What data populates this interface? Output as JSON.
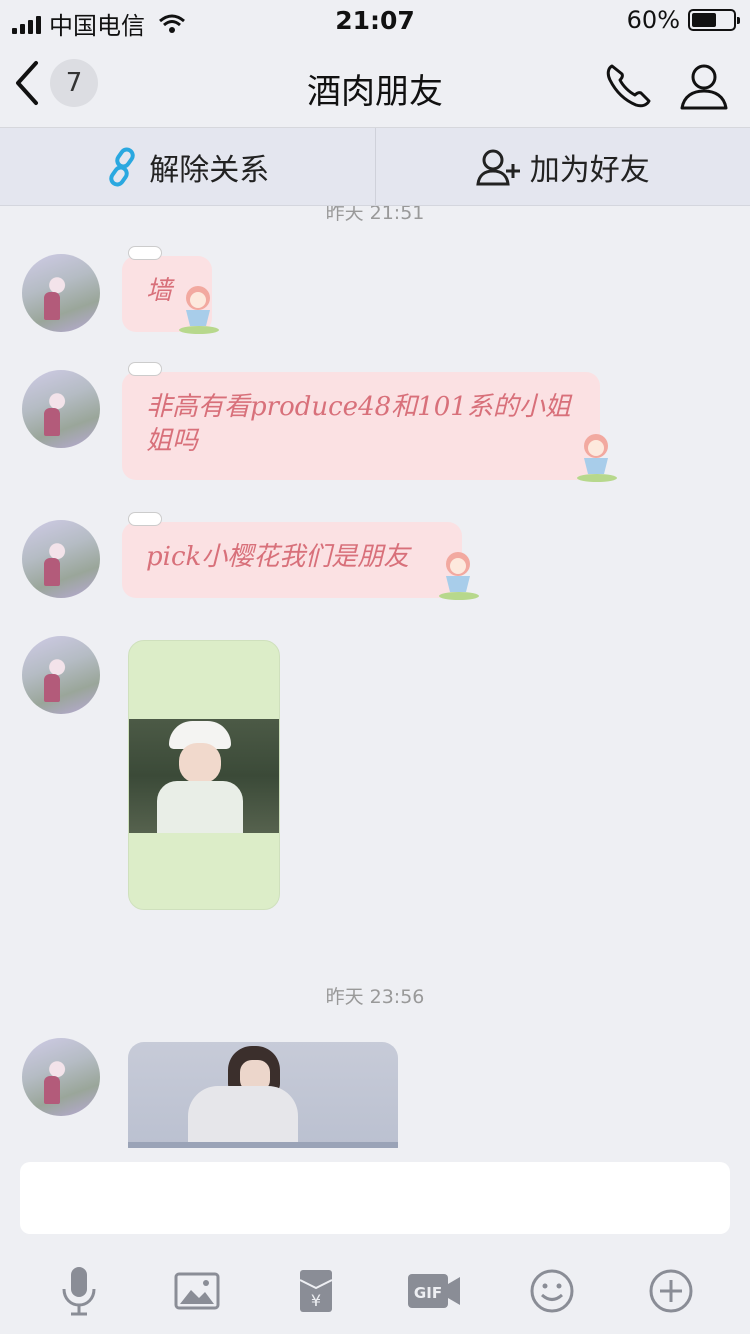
{
  "status_bar": {
    "carrier": "中国电信",
    "time": "21:07",
    "battery": "60%",
    "battery_level": 0.6
  },
  "nav": {
    "unread_count": "7",
    "title": "酒肉朋友"
  },
  "actions": {
    "unlink_label": "解除关系",
    "add_friend_label": "加为好友"
  },
  "messages": {
    "timestamp_1": "昨天 21:51",
    "msg_1": "墙",
    "msg_2": "非高有看produce48和101系的小姐姐吗",
    "msg_3": "pick小樱花我们是朋友",
    "timestamp_2": "昨天 23:56"
  },
  "colors": {
    "bubble_bg": "#fbe1e3",
    "bubble_text": "#d8707a",
    "accent": "#2aa8e0"
  },
  "toolbar": {
    "icons": [
      "microphone-icon",
      "image-icon",
      "red-packet-icon",
      "gif-icon",
      "emoji-icon",
      "plus-icon"
    ]
  }
}
